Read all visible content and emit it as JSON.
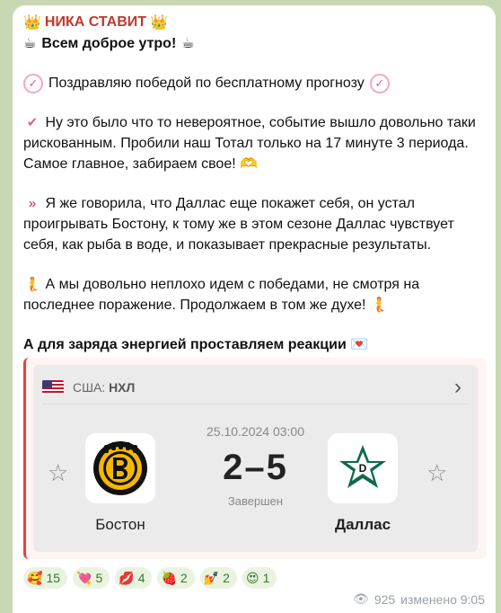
{
  "message": {
    "channel_name": "НИКА СТАВИТ",
    "greeting": "Всем доброе утро!",
    "congrats": "Поздравляю победой по бесплатному прогнозу",
    "para1": "Ну это было что то невероятное, событие вышло довольно таки рискованным. Пробили наш Тотал только на 17 минуте 3 периода. Самое главное, забираем свое!",
    "para2": "Я же говорила, что Даллас еще покажет себя, он устал проигрывать Бостону, к тому же в этом сезоне Даллас чувствует себя, как рыба в воде, и показывает прекрасные результаты.",
    "para3": "А мы довольно неплохо идем с победами, не смотря на последнее поражение. Продолжаем в том же духе!",
    "call_to_action": "А для заряда энергией проставляем реакции"
  },
  "match": {
    "league_country": "США:",
    "league_name": "НХЛ",
    "date_time": "25.10.2024 03:00",
    "score": "2–5",
    "status": "Завершен",
    "home_team": "Бостон",
    "away_team": "Даллас"
  },
  "reactions": [
    {
      "emoji": "🥰",
      "count": "15"
    },
    {
      "emoji": "💘",
      "count": "5"
    },
    {
      "emoji": "💋",
      "count": "4"
    },
    {
      "emoji": "🍓",
      "count": "2"
    },
    {
      "emoji": "💅",
      "count": "2"
    },
    {
      "emoji": "😍",
      "count": "1"
    }
  ],
  "meta": {
    "views": "925",
    "edited": "изменено 9:05"
  },
  "colors": {
    "channel": "#c0392b",
    "accent_border": "#e8423a",
    "reaction_text": "#2e7d32",
    "background": "#c9d8b4"
  }
}
